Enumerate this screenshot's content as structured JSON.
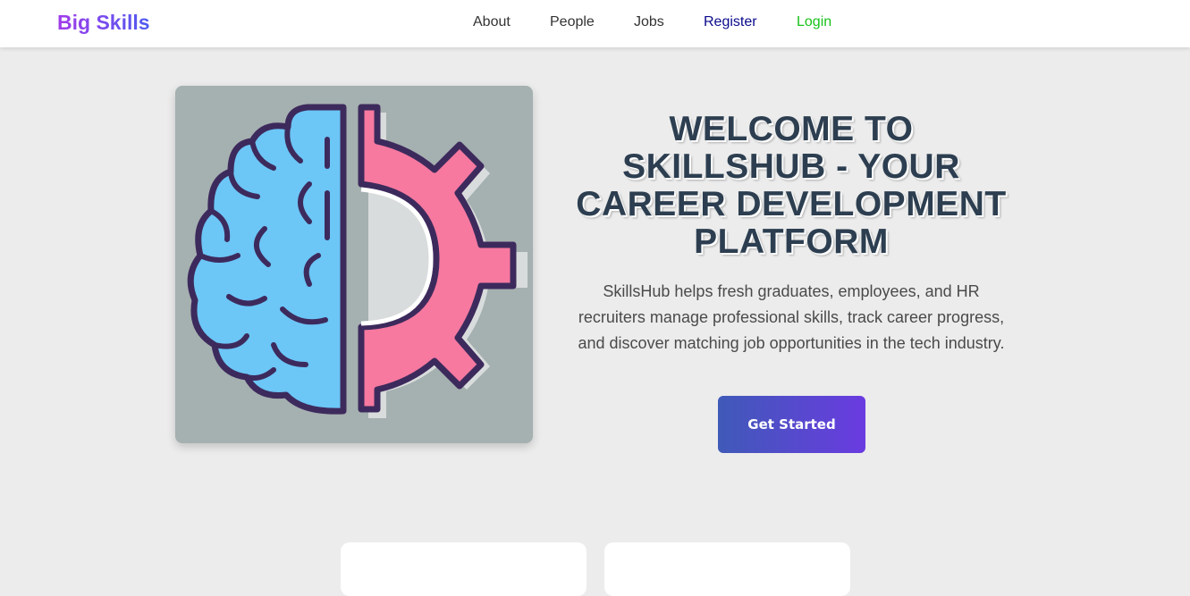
{
  "navbar": {
    "brand": "Big Skills",
    "links": [
      {
        "label": "About",
        "color": "#333333"
      },
      {
        "label": "People",
        "color": "#333333"
      },
      {
        "label": "Jobs",
        "color": "#333333"
      },
      {
        "label": "Register",
        "color": "#0a0a8c"
      },
      {
        "label": "Login",
        "color": "#17c21a"
      }
    ]
  },
  "hero": {
    "image_icon": "brain-gear-icon",
    "title": "WELCOME TO SKILLSHUB - YOUR CAREER DEVELOPMENT PLATFORM",
    "description": "SkillsHub helps fresh graduates, employees, and HR recruiters manage professional skills, track career progress, and discover matching job opportunities in the tech industry.",
    "cta_label": "Get Started"
  },
  "colors": {
    "brand_gradient_start": "#a23bea",
    "brand_gradient_end": "#4f5bf0",
    "cta_gradient_start": "#3f5ab8",
    "cta_gradient_end": "#6a3be0",
    "title": "#2c3e50",
    "brain": "#6cc6f6",
    "gear": "#f779a0",
    "outline": "#3d2a5c"
  }
}
